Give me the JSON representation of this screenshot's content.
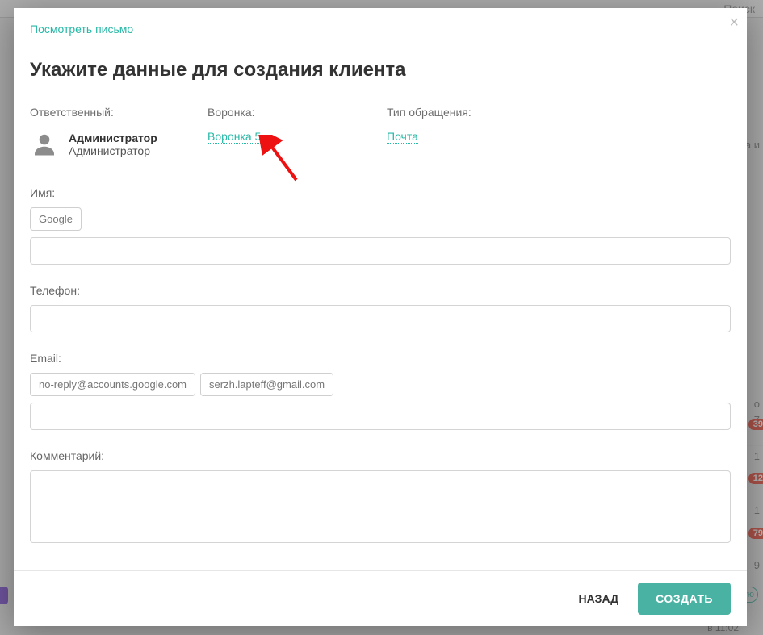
{
  "background": {
    "search_placeholder": "Поиск",
    "date_header": "ата и",
    "rows": [
      {
        "text": "о"
      },
      {
        "text": "7"
      },
      {
        "text": "1",
        "badge": "39"
      },
      {
        "text": "1",
        "badge": "12"
      },
      {
        "text": "9",
        "badge": "79"
      }
    ],
    "bottom_btn": "ую",
    "bottom_time": "в 11:02"
  },
  "modal": {
    "view_letter": "Посмотреть письмо",
    "title": "Укажите данные для создания клиента",
    "close": "×",
    "responsible": {
      "label": "Ответственный:",
      "name": "Администратор",
      "sub": "Администратор"
    },
    "funnel": {
      "label": "Воронка:",
      "value": "Воронка 5"
    },
    "request_type": {
      "label": "Тип обращения:",
      "value": "Почта"
    },
    "name_field": {
      "label": "Имя:",
      "suggestions": [
        "Google"
      ],
      "value": ""
    },
    "phone_field": {
      "label": "Телефон:",
      "value": ""
    },
    "email_field": {
      "label": "Email:",
      "suggestions": [
        "no-reply@accounts.google.com",
        "serzh.lapteff@gmail.com"
      ],
      "value": ""
    },
    "comment_field": {
      "label": "Комментарий:",
      "value": ""
    },
    "footer": {
      "back": "НАЗАД",
      "create": "СОЗДАТЬ"
    }
  }
}
